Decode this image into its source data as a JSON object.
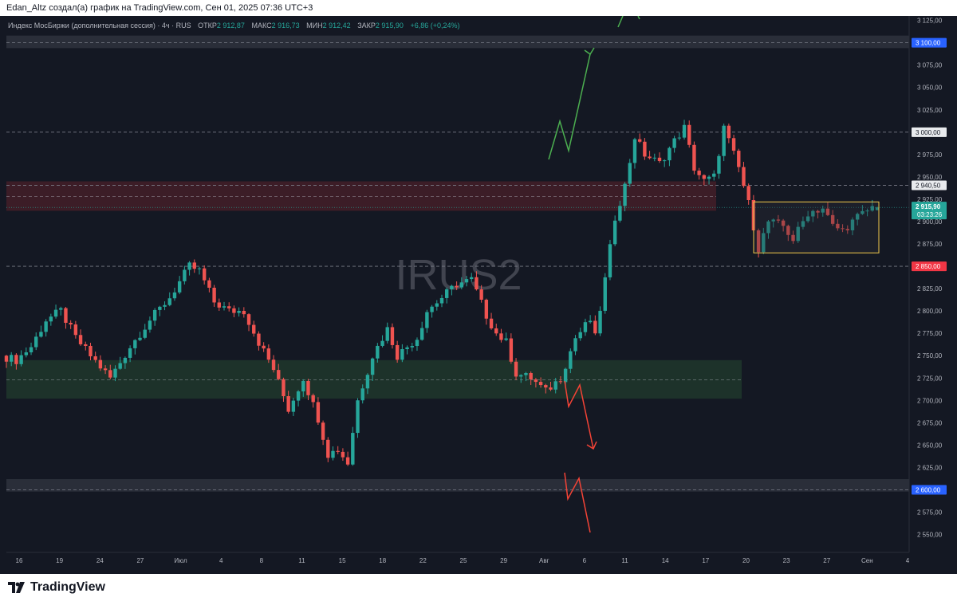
{
  "header": {
    "caption": "Edan_Altz создал(а) график на TradingView.com, Сен 01, 2025 07:36 UTC+3"
  },
  "legend": {
    "symbol_title": "Индекс МосБиржи (дополнительная сессия) · 4ч · RUS",
    "open_label": "ОТКР",
    "open_value": "2 912,87",
    "high_label": "МАКС",
    "high_value": "2 916,73",
    "low_label": "МИН",
    "low_value": "2 912,42",
    "close_label": "ЗАКР",
    "close_value": "2 915,90",
    "change": "+6,86 (+0,24%)"
  },
  "watermark": "IRUS2",
  "price_axis": {
    "ticks": [
      "3 125,00",
      "3 075,00",
      "3 050,00",
      "3 025,00",
      "2 975,00",
      "2 950,00",
      "2 925,00",
      "2 900,00",
      "2 875,00",
      "2 825,00",
      "2 800,00",
      "2 775,00",
      "2 750,00",
      "2 725,00",
      "2 700,00",
      "2 675,00",
      "2 650,00",
      "2 625,00",
      "2 575,00",
      "2 550,00"
    ],
    "badges": [
      {
        "price": 3100,
        "text": "3 100,00",
        "color": "#2962ff"
      },
      {
        "price": 3000,
        "text": "3 000,00",
        "color": "#e8eaed"
      },
      {
        "price": 2940.5,
        "text": "2 940,50",
        "color": "#e8eaed"
      },
      {
        "price": 2850,
        "text": "2 850,00",
        "color": "#f23645"
      },
      {
        "price": 2600,
        "text": "2 600,00",
        "color": "#2962ff"
      }
    ],
    "last_price": "2 915,90",
    "countdown": "03:23:26"
  },
  "time_axis": {
    "labels": [
      "16",
      "19",
      "24",
      "27",
      "Июл",
      "4",
      "8",
      "11",
      "15",
      "18",
      "22",
      "25",
      "29",
      "Авг",
      "6",
      "11",
      "14",
      "17",
      "20",
      "23",
      "27",
      "Сен",
      "4"
    ]
  },
  "colors": {
    "up": "#26a69a",
    "down": "#ef5350",
    "background": "#141823",
    "support_zone": "#1f3a2c",
    "resistance_zone": "#4a1f2a",
    "range_box": "#f2c94c",
    "arrow_up": "#4caf50",
    "arrow_down": "#f44336"
  },
  "brand": {
    "name": "TradingView"
  },
  "chart_data": {
    "type": "candlestick",
    "title": "Индекс МосБиржи (дополнительная сессия) · 4ч · RUS",
    "ylim": [
      2530,
      3130
    ],
    "x_labels": [
      "16",
      "19",
      "24",
      "27",
      "Июл",
      "4",
      "8",
      "11",
      "15",
      "18",
      "22",
      "25",
      "29",
      "Авг",
      "6",
      "11",
      "14",
      "17",
      "20",
      "23",
      "27",
      "Сен",
      "4"
    ],
    "anchors": [
      [
        0,
        2750
      ],
      [
        3,
        2745
      ],
      [
        6,
        2760
      ],
      [
        9,
        2790
      ],
      [
        12,
        2800
      ],
      [
        15,
        2770
      ],
      [
        18,
        2750
      ],
      [
        22,
        2725
      ],
      [
        26,
        2760
      ],
      [
        30,
        2790
      ],
      [
        34,
        2815
      ],
      [
        38,
        2850
      ],
      [
        40,
        2845
      ],
      [
        43,
        2810
      ],
      [
        46,
        2800
      ],
      [
        49,
        2800
      ],
      [
        52,
        2765
      ],
      [
        55,
        2735
      ],
      [
        58,
        2690
      ],
      [
        61,
        2725
      ],
      [
        64,
        2680
      ],
      [
        66,
        2640
      ],
      [
        68,
        2645
      ],
      [
        70,
        2630
      ],
      [
        72,
        2700
      ],
      [
        75,
        2750
      ],
      [
        78,
        2780
      ],
      [
        80,
        2750
      ],
      [
        82,
        2760
      ],
      [
        84,
        2770
      ],
      [
        86,
        2800
      ],
      [
        89,
        2815
      ],
      [
        92,
        2830
      ],
      [
        95,
        2835
      ],
      [
        98,
        2795
      ],
      [
        100,
        2775
      ],
      [
        102,
        2765
      ],
      [
        104,
        2730
      ],
      [
        107,
        2725
      ],
      [
        110,
        2710
      ],
      [
        113,
        2725
      ],
      [
        116,
        2770
      ],
      [
        119,
        2790
      ],
      [
        120,
        2770
      ],
      [
        122,
        2835
      ],
      [
        123,
        2870
      ],
      [
        124,
        2905
      ],
      [
        126,
        2940
      ],
      [
        128,
        2995
      ],
      [
        130,
        2975
      ],
      [
        133,
        2965
      ],
      [
        136,
        2990
      ],
      [
        138,
        3005
      ],
      [
        140,
        2960
      ],
      [
        142,
        2945
      ],
      [
        144,
        2950
      ],
      [
        146,
        3005
      ],
      [
        147,
        2990
      ],
      [
        149,
        2960
      ],
      [
        151,
        2920
      ],
      [
        153,
        2870
      ],
      [
        155,
        2900
      ],
      [
        158,
        2895
      ],
      [
        160,
        2880
      ],
      [
        163,
        2910
      ],
      [
        166,
        2915
      ],
      [
        168,
        2895
      ],
      [
        170,
        2890
      ],
      [
        173,
        2905
      ],
      [
        176,
        2916
      ]
    ],
    "candle_count": 177,
    "last": {
      "open": 2912.87,
      "high": 2916.73,
      "low": 2912.42,
      "close": 2915.9
    },
    "horizontal_levels": [
      3100,
      3000,
      2940.5,
      2850,
      2600
    ],
    "zones": [
      {
        "label": "resistance",
        "from": 2912,
        "to": 2945
      },
      {
        "label": "support",
        "from": 2702,
        "to": 2745
      },
      {
        "label": "range",
        "from": 2865,
        "to": 2922
      }
    ]
  }
}
